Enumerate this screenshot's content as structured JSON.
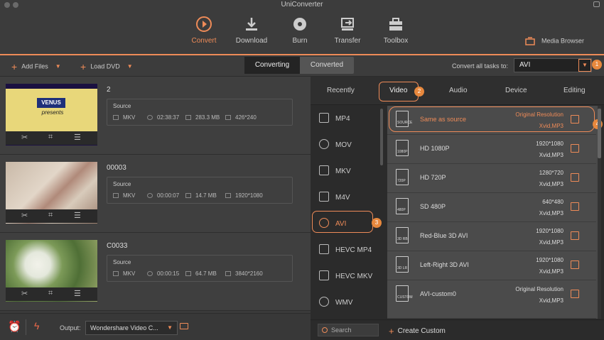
{
  "window": {
    "title": "UniConverter"
  },
  "nav": {
    "items": [
      {
        "label": "Convert",
        "icon": "convert-icon"
      },
      {
        "label": "Download",
        "icon": "download-icon"
      },
      {
        "label": "Burn",
        "icon": "burn-icon"
      },
      {
        "label": "Transfer",
        "icon": "transfer-icon"
      },
      {
        "label": "Toolbox",
        "icon": "toolbox-icon"
      }
    ],
    "active": "Convert",
    "media_browser": "Media Browser"
  },
  "toolbar": {
    "add_files": "Add Files",
    "load_dvd": "Load DVD",
    "tab_converting": "Converting",
    "tab_converted": "Converted",
    "convert_all_label": "Convert all tasks to:",
    "convert_all_value": "AVI"
  },
  "files": [
    {
      "name": "2",
      "source_label": "Source",
      "format": "MKV",
      "duration": "02:38:37",
      "size": "283.3 MB",
      "resolution": "426*240",
      "thumb_text_1": "VENUS",
      "thumb_text_2": "presents"
    },
    {
      "name": "00003",
      "source_label": "Source",
      "format": "MKV",
      "duration": "00:00:07",
      "size": "14.7 MB",
      "resolution": "1920*1080"
    },
    {
      "name": "C0033",
      "source_label": "Source",
      "format": "MKV",
      "duration": "00:00:15",
      "size": "64.7 MB",
      "resolution": "3840*2160"
    }
  ],
  "bottom": {
    "output_label": "Output:",
    "output_value": "Wondershare Video C..."
  },
  "panel": {
    "categories": [
      "Recently",
      "Video",
      "Audio",
      "Device",
      "Editing"
    ],
    "active_category": "Video",
    "formats": [
      "MP4",
      "MOV",
      "MKV",
      "M4V",
      "AVI",
      "HEVC MP4",
      "HEVC MKV",
      "WMV"
    ],
    "active_format": "AVI",
    "resolutions": [
      {
        "name": "Same as source",
        "res": "Original Resolution",
        "codec": "Xvid,MP3",
        "icon_text": "SOURCE"
      },
      {
        "name": "HD 1080P",
        "res": "1920*1080",
        "codec": "Xvid,MP3",
        "icon_text": "1080P"
      },
      {
        "name": "HD 720P",
        "res": "1280*720",
        "codec": "Xvid,MP3",
        "icon_text": "720P"
      },
      {
        "name": "SD 480P",
        "res": "640*480",
        "codec": "Xvid,MP3",
        "icon_text": "480P"
      },
      {
        "name": "Red-Blue 3D AVI",
        "res": "1920*1080",
        "codec": "Xvid,MP3",
        "icon_text": "3D RB"
      },
      {
        "name": "Left-Right 3D AVI",
        "res": "1920*1080",
        "codec": "Xvid,MP3",
        "icon_text": "3D LR"
      },
      {
        "name": "AVI-custom0",
        "res": "Original Resolution",
        "codec": "Xvid,MP3",
        "icon_text": "CUSTOM"
      }
    ],
    "search_placeholder": "Search",
    "create_custom": "Create Custom"
  },
  "badges": [
    "1",
    "2",
    "3",
    "4"
  ],
  "colors": {
    "accent": "#ee8b58",
    "background": "#3a3a3a",
    "panel": "#2b2b2b"
  }
}
